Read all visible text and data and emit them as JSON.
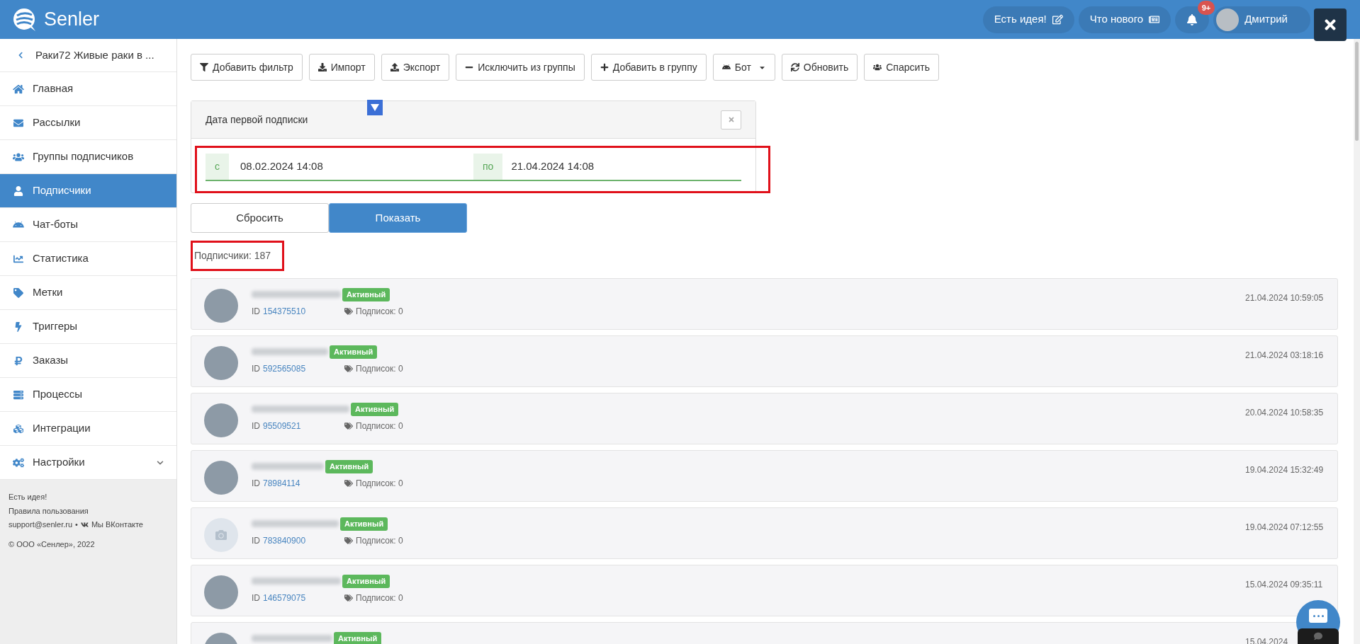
{
  "header": {
    "logo": "Senler",
    "pills": [
      {
        "label": "Есть идея!",
        "kind": "idea"
      },
      {
        "label": "Что нового",
        "kind": "news"
      }
    ],
    "notifications_badge": "9+",
    "user": "Дмитрий"
  },
  "sidebar": {
    "back": "Раки72 Живые раки в ...",
    "items": [
      {
        "label": "Главная",
        "selected": false,
        "kind": "link"
      },
      {
        "label": "Рассылки",
        "selected": false,
        "kind": "link"
      },
      {
        "label": "Группы подписчиков",
        "selected": false,
        "kind": "link"
      },
      {
        "label": "Подписчики",
        "selected": true,
        "kind": "link"
      },
      {
        "label": "Чат-боты",
        "selected": false,
        "kind": "link"
      },
      {
        "label": "Статистика",
        "selected": false,
        "kind": "link"
      },
      {
        "label": "Метки",
        "selected": false,
        "kind": "link"
      },
      {
        "label": "Триггеры",
        "selected": false,
        "kind": "link"
      },
      {
        "label": "Заказы",
        "selected": false,
        "kind": "link"
      },
      {
        "label": "Процессы",
        "selected": false,
        "kind": "link"
      },
      {
        "label": "Интеграции",
        "selected": false,
        "kind": "link"
      },
      {
        "label": "Настройки",
        "selected": false,
        "kind": "submenu"
      }
    ],
    "footer": {
      "idea": "Есть идея!",
      "rules": "Правила пользования",
      "email": "support@senler.ru",
      "separator": "•",
      "vk": "Мы ВКонтакте",
      "copyright": "© ООО «Сенлер», 2022"
    }
  },
  "toolbar": [
    {
      "label": "Добавить фильтр",
      "kind": "button"
    },
    {
      "label": "Импорт",
      "kind": "button"
    },
    {
      "label": "Экспорт",
      "kind": "button"
    },
    {
      "label": "Исключить из группы",
      "kind": "button"
    },
    {
      "label": "Добавить в группу",
      "kind": "button"
    },
    {
      "label": "Бот",
      "kind": "dropdown"
    },
    {
      "label": "Обновить",
      "kind": "button"
    },
    {
      "label": "Спарсить",
      "kind": "button"
    }
  ],
  "filter": {
    "title": "Дата первой подписки",
    "from_prefix": "с",
    "from": "08.02.2024 14:08",
    "to_prefix": "по",
    "to": "21.04.2024 14:08"
  },
  "actions": [
    {
      "label": "Сбросить",
      "primary": false
    },
    {
      "label": "Показать",
      "primary": true
    }
  ],
  "count": "Подписчики: 187",
  "subscribers": [
    {
      "status": "Активный",
      "id_label": "ID",
      "id": "154375510",
      "subscriptions": "Подписок: 0",
      "date": "21.04.2024 10:59:05",
      "photo": true
    },
    {
      "status": "Активный",
      "id_label": "ID",
      "id": "592565085",
      "subscriptions": "Подписок: 0",
      "date": "21.04.2024 03:18:16",
      "photo": true
    },
    {
      "status": "Активный",
      "id_label": "ID",
      "id": "95509521",
      "subscriptions": "Подписок: 0",
      "date": "20.04.2024 10:58:35",
      "photo": true
    },
    {
      "status": "Активный",
      "id_label": "ID",
      "id": "78984114",
      "subscriptions": "Подписок: 0",
      "date": "19.04.2024 15:32:49",
      "photo": true
    },
    {
      "status": "Активный",
      "id_label": "ID",
      "id": "783840900",
      "subscriptions": "Подписок: 0",
      "date": "19.04.2024 07:12:55",
      "photo": false
    },
    {
      "status": "Активный",
      "id_label": "ID",
      "id": "146579075",
      "subscriptions": "Подписок: 0",
      "date": "15.04.2024 09:35:11",
      "photo": true
    },
    {
      "status": "Активный",
      "date": "15.04.2024",
      "photo": true
    }
  ]
}
